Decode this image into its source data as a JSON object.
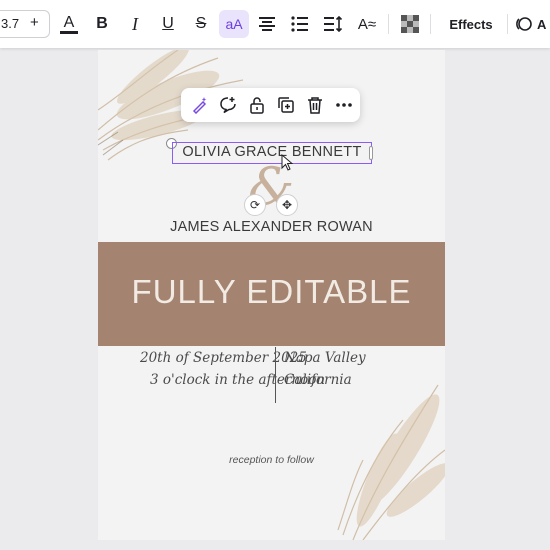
{
  "toolbar": {
    "font_size": "3.7",
    "plus": "+",
    "effects_label": "Effects",
    "partial_label": "A"
  },
  "context_menu": {
    "icons": [
      "magic-edit-icon",
      "comment-icon",
      "lock-icon",
      "duplicate-icon",
      "trash-icon",
      "more-icon"
    ]
  },
  "canvas": {
    "name_top": "OLIVIA GRACE BENNETT",
    "ampersand": "&",
    "name_bottom": "JAMES ALEXANDER ROWAN",
    "banner": "FULLY EDITABLE",
    "date_line1": "20th of September 2025",
    "date_line2": "3 o'clock in the afternoon",
    "venue_line1": "Napa Valley",
    "venue_line2": "California",
    "reception": "reception to follow"
  },
  "colors": {
    "accent": "#8b5cf6",
    "banner": "#a48470",
    "page": "#f3f3f3"
  }
}
